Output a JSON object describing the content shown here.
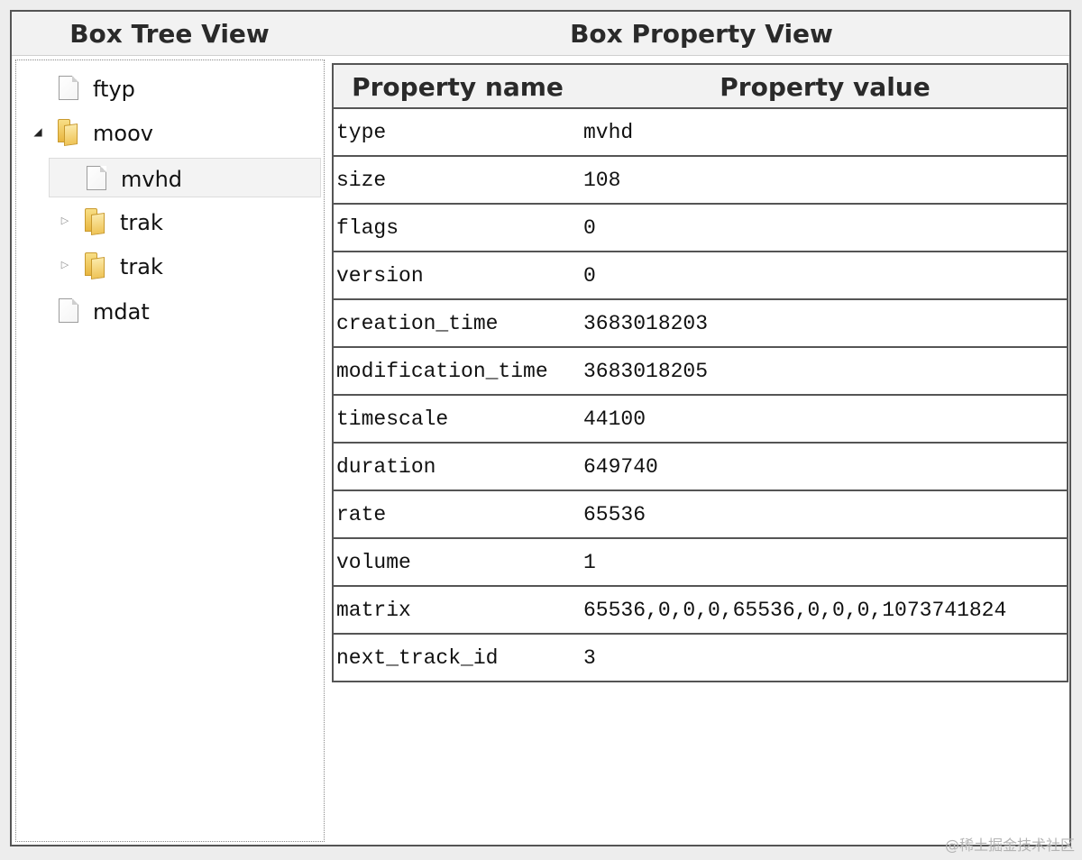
{
  "titles": {
    "tree": "Box Tree View",
    "properties": "Box Property View"
  },
  "tree": {
    "items": [
      {
        "label": "ftyp",
        "type": "file",
        "level": 0,
        "expander": "none"
      },
      {
        "label": "moov",
        "type": "folder",
        "level": 0,
        "expander": "expanded"
      },
      {
        "label": "mvhd",
        "type": "file",
        "level": 1,
        "expander": "none",
        "selected": true
      },
      {
        "label": "trak",
        "type": "folder",
        "level": 1,
        "expander": "collapsed"
      },
      {
        "label": "trak",
        "type": "folder",
        "level": 1,
        "expander": "collapsed"
      },
      {
        "label": "mdat",
        "type": "file",
        "level": 0,
        "expander": "none"
      }
    ]
  },
  "table": {
    "headers": [
      "Property name",
      "Property value"
    ],
    "rows": [
      {
        "name": "type",
        "value": "mvhd"
      },
      {
        "name": "size",
        "value": "108"
      },
      {
        "name": "flags",
        "value": "0"
      },
      {
        "name": "version",
        "value": "0"
      },
      {
        "name": "creation_time",
        "value": "3683018203"
      },
      {
        "name": "modification_time",
        "value": "3683018205"
      },
      {
        "name": "timescale",
        "value": "44100"
      },
      {
        "name": "duration",
        "value": "649740"
      },
      {
        "name": "rate",
        "value": "65536"
      },
      {
        "name": "volume",
        "value": "1"
      },
      {
        "name": "matrix",
        "value": "65536,0,0,0,65536,0,0,0,1073741824"
      },
      {
        "name": "next_track_id",
        "value": "3"
      }
    ]
  },
  "icons": {
    "file": "file-icon",
    "folder": "folder-icon",
    "expanded": "triangle-down-icon",
    "collapsed": "triangle-right-icon"
  },
  "watermark": "@稀土掘金技术社区"
}
